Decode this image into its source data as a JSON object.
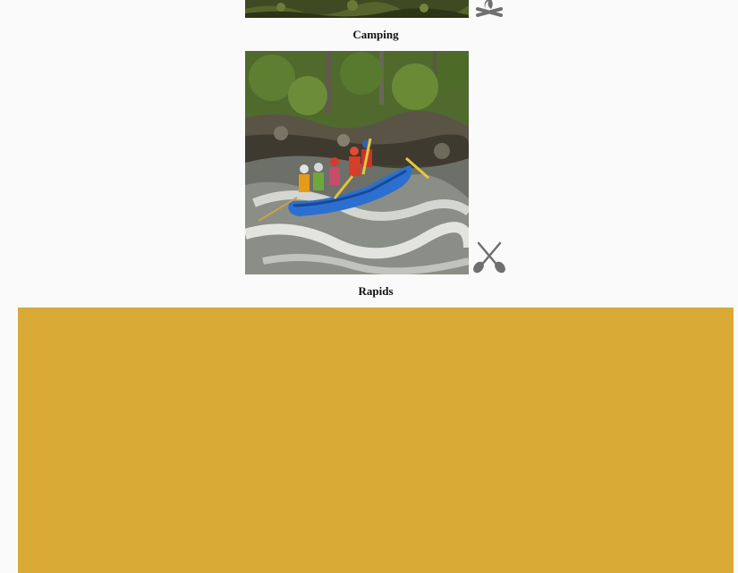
{
  "activities": [
    {
      "caption": "Camping",
      "icon": "campfire-icon"
    },
    {
      "caption": "Rapids",
      "icon": "crossed-paddles-icon"
    }
  ],
  "colors": {
    "background": "#fafafa",
    "banner": "#d9aa36",
    "icon": "#6f6f6f"
  }
}
